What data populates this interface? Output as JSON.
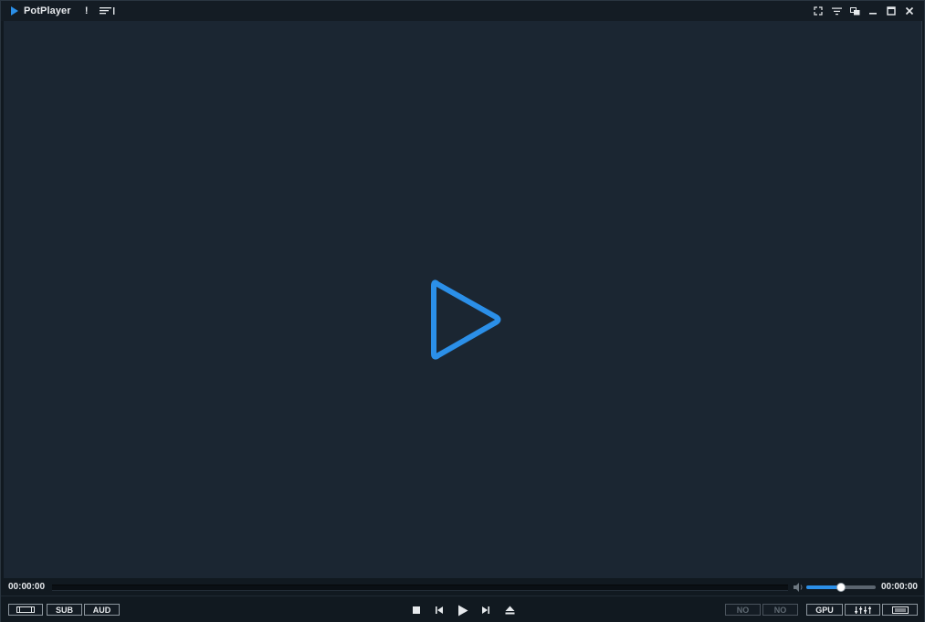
{
  "app": {
    "title": "PotPlayer",
    "accent_color": "#2b8fe8"
  },
  "titlebar": {
    "alert_icon_glyph": "!",
    "icons": [
      "playlist-icon",
      "fullscreen-icon",
      "filter-icon",
      "window-mode-icon",
      "minimize-icon",
      "maximize-icon",
      "close-icon"
    ]
  },
  "seek": {
    "current_time": "00:00:00",
    "total_time": "00:00:00",
    "progress_percent": 0
  },
  "volume": {
    "level_percent": 50
  },
  "buttons": {
    "sub_label": "SUB",
    "aud_label": "AUD",
    "no1_label": "NO",
    "no2_label": "NO",
    "gpu_label": "GPU"
  },
  "playback_icons": [
    "stop-icon",
    "previous-icon",
    "play-icon",
    "next-icon",
    "eject-icon"
  ]
}
